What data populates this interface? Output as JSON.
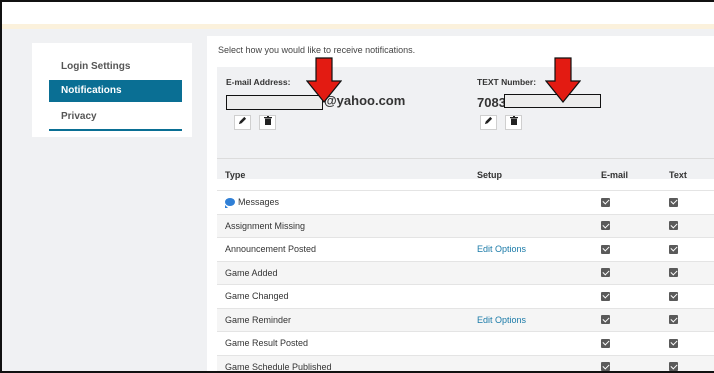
{
  "sidebar": {
    "items": [
      {
        "label": "Login Settings"
      },
      {
        "label": "Notifications"
      },
      {
        "label": "Privacy"
      }
    ]
  },
  "main": {
    "instructions": "Select how you would like to receive notifications.",
    "email": {
      "label": "E-mail Address:",
      "suffix": "@yahoo.com"
    },
    "text": {
      "label": "TEXT Number:",
      "prefix": "7083"
    },
    "icons": {
      "edit": "pencil-icon",
      "delete": "trash-icon"
    }
  },
  "table": {
    "headers": {
      "type": "Type",
      "setup": "Setup",
      "email": "E-mail",
      "text": "Text"
    },
    "rows": [
      {
        "type": "Messages",
        "setup": "",
        "email": true,
        "text": true
      },
      {
        "type": "Assignment Missing",
        "setup": "",
        "email": true,
        "text": true
      },
      {
        "type": "Announcement Posted",
        "setup": "Edit Options",
        "email": true,
        "text": true
      },
      {
        "type": "Game Added",
        "setup": "",
        "email": true,
        "text": true
      },
      {
        "type": "Game Changed",
        "setup": "",
        "email": true,
        "text": true
      },
      {
        "type": "Game Reminder",
        "setup": "Edit Options",
        "email": true,
        "text": true
      },
      {
        "type": "Game Result Posted",
        "setup": "",
        "email": true,
        "text": true
      },
      {
        "type": "Game Schedule Published",
        "setup": "",
        "email": true,
        "text": true
      }
    ]
  },
  "colors": {
    "accent": "#0a6f94",
    "link": "#1a7aa8",
    "annotation_arrow": "#e31b12"
  }
}
